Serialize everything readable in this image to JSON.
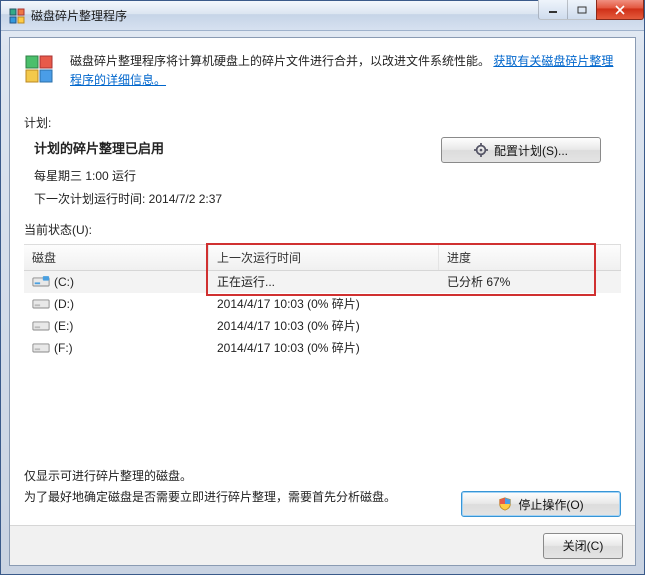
{
  "window": {
    "title": "磁盘碎片整理程序"
  },
  "info": {
    "text_prefix": "磁盘碎片整理程序将计算机硬盘上的碎片文件进行合并，以改进文件系统性能。",
    "link_text": "获取有关磁盘碎片整理程序的详细信息。"
  },
  "schedule": {
    "section_label": "计划:",
    "heading": "计划的碎片整理已启用",
    "line1": "每星期三 1:00 运行",
    "line2": "下一次计划运行时间: 2014/7/2 2:37",
    "configure_button": "配置计划(S)..."
  },
  "status": {
    "section_label": "当前状态(U):",
    "columns": {
      "disk": "磁盘",
      "last": "上一次运行时间",
      "progress": "进度"
    },
    "rows": [
      {
        "name": "(C:)",
        "system": true,
        "last": "正在运行...",
        "progress": "已分析 67%",
        "selected": true
      },
      {
        "name": "(D:)",
        "system": false,
        "last": "2014/4/17 10:03 (0% 碎片)",
        "progress": "",
        "selected": false
      },
      {
        "name": "(E:)",
        "system": false,
        "last": "2014/4/17 10:03 (0% 碎片)",
        "progress": "",
        "selected": false
      },
      {
        "name": "(F:)",
        "system": false,
        "last": "2014/4/17 10:03 (0% 碎片)",
        "progress": "",
        "selected": false
      }
    ]
  },
  "notes": {
    "line1": "仅显示可进行碎片整理的磁盘。",
    "line2": "为了最好地确定磁盘是否需要立即进行碎片整理，需要首先分析磁盘。"
  },
  "buttons": {
    "stop": "停止操作(O)",
    "close": "关闭(C)"
  }
}
